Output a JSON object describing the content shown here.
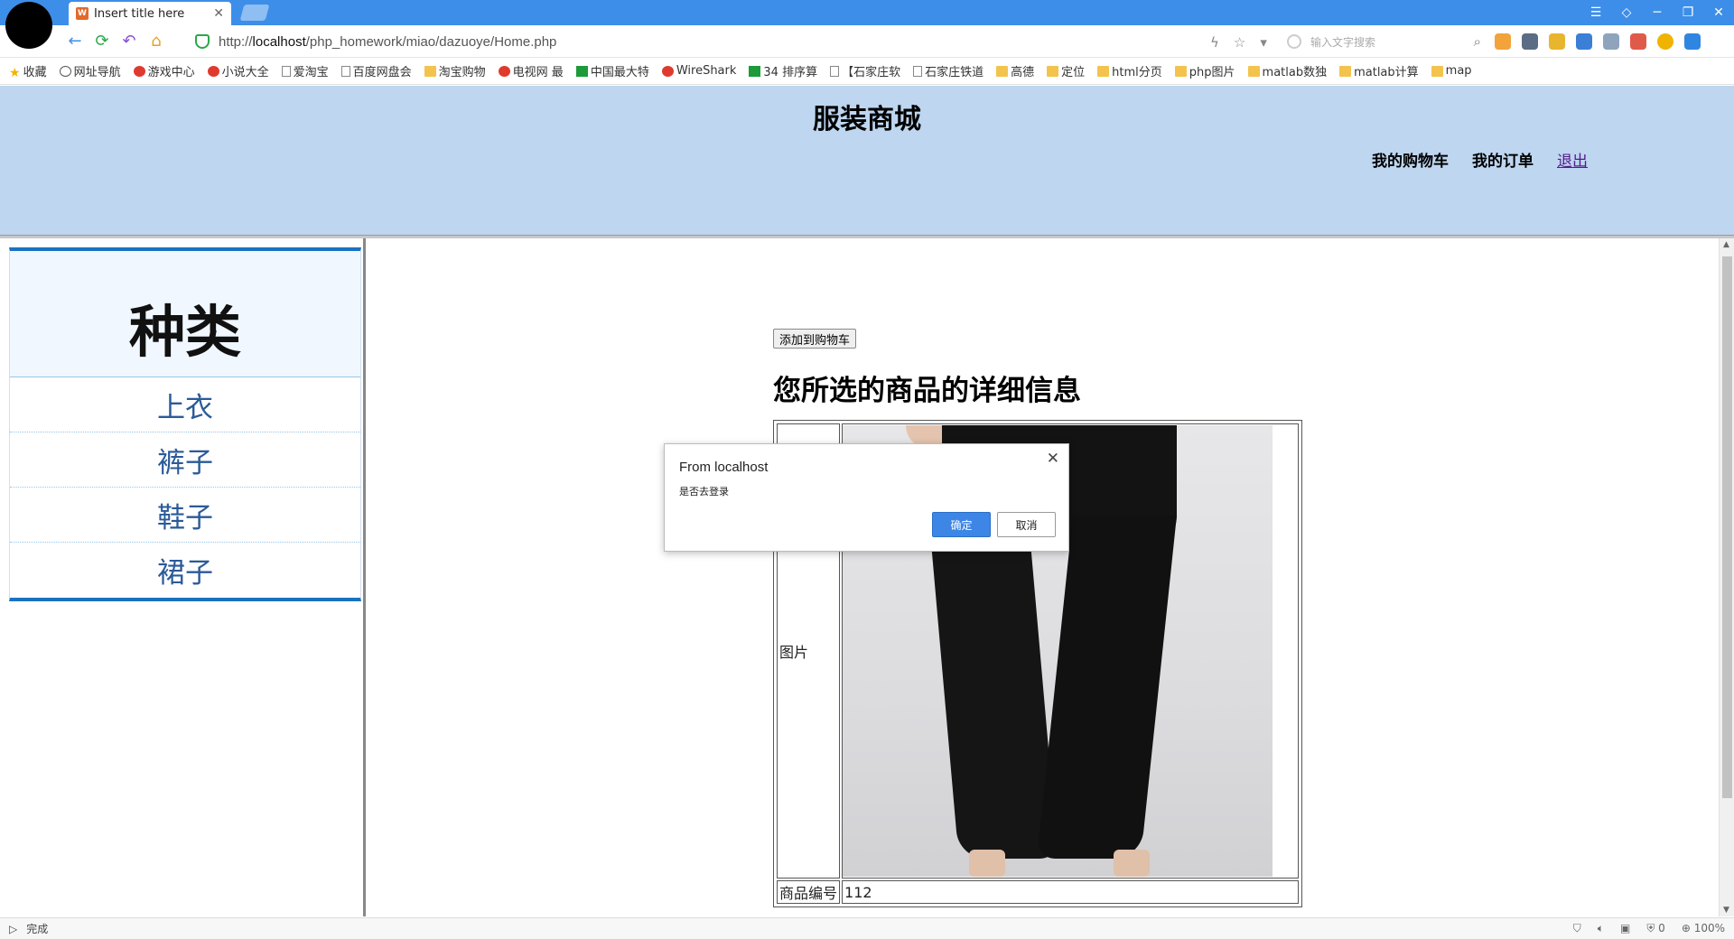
{
  "browser": {
    "tab_title": "Insert title here",
    "url_prefix": "http://",
    "url_host": "localhost",
    "url_path": "/php_homework/miao/dazuoye/Home.php",
    "search_placeholder": "输入文字搜索",
    "zoom": "100%",
    "status": "完成",
    "security_count": "0",
    "bookmarks": [
      {
        "label": "收藏",
        "icon": "star"
      },
      {
        "label": "网址导航",
        "icon": "globe"
      },
      {
        "label": "游戏中心",
        "icon": "red"
      },
      {
        "label": "小说大全",
        "icon": "red"
      },
      {
        "label": "爱淘宝",
        "icon": "page"
      },
      {
        "label": "百度网盘会",
        "icon": "page"
      },
      {
        "label": "淘宝购物",
        "icon": "folder"
      },
      {
        "label": "电视网 最",
        "icon": "red"
      },
      {
        "label": "中国最大特",
        "icon": "green"
      },
      {
        "label": "WireShark",
        "icon": "red"
      },
      {
        "label": "34 排序算",
        "icon": "green"
      },
      {
        "label": "【石家庄软",
        "icon": "page"
      },
      {
        "label": "石家庄铁道",
        "icon": "page"
      },
      {
        "label": "高德",
        "icon": "folder"
      },
      {
        "label": "定位",
        "icon": "folder"
      },
      {
        "label": "html分页",
        "icon": "folder"
      },
      {
        "label": "php图片",
        "icon": "folder"
      },
      {
        "label": "matlab数独",
        "icon": "folder"
      },
      {
        "label": "matlab计算",
        "icon": "folder"
      },
      {
        "label": "map",
        "icon": "folder"
      }
    ]
  },
  "header": {
    "title": "服装商城",
    "links": {
      "cart": "我的购物车",
      "orders": "我的订单",
      "logout": "退出"
    }
  },
  "sidebar": {
    "heading": "种类",
    "items": [
      "上衣",
      "裤子",
      "鞋子",
      "裙子"
    ]
  },
  "main": {
    "add_to_cart": "添加到购物车",
    "detail_title": "您所选的商品的详细信息",
    "rows": [
      {
        "label": "图片",
        "value": ""
      },
      {
        "label": "商品编号",
        "value": "112"
      }
    ]
  },
  "dialog": {
    "title": "From localhost",
    "message": "是否去登录",
    "ok": "确定",
    "cancel": "取消"
  }
}
